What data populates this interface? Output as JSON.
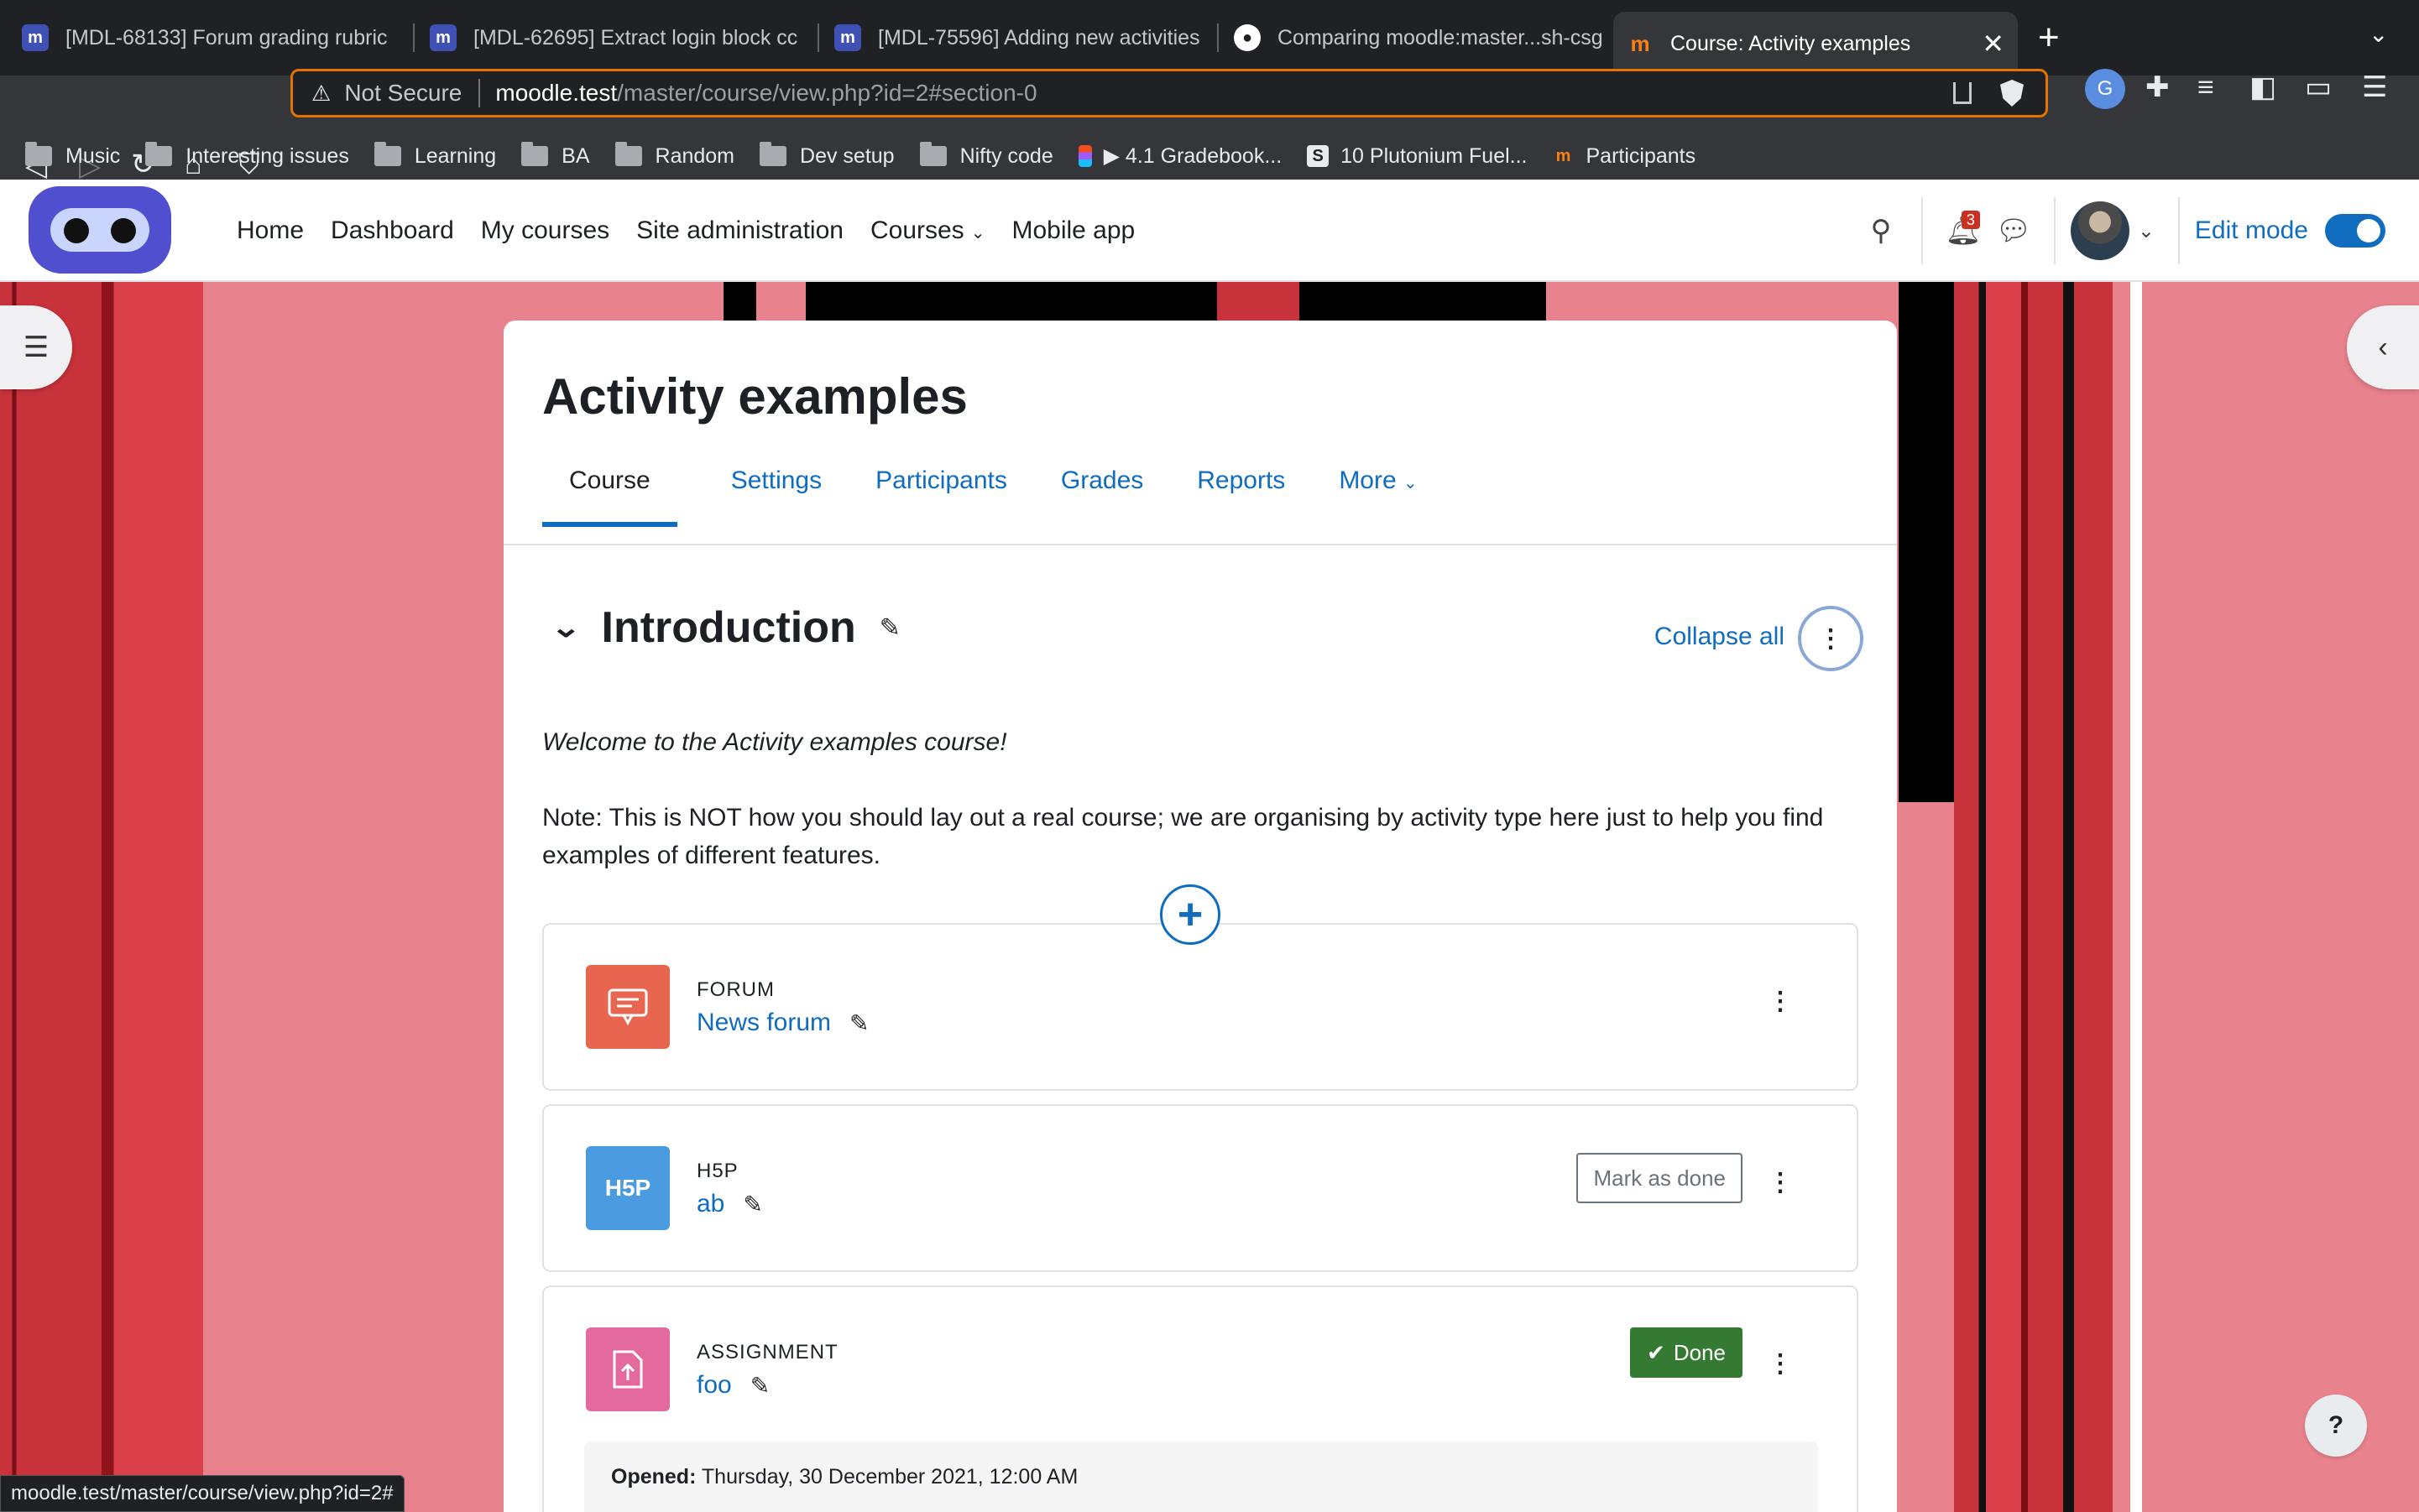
{
  "browser": {
    "tabs": [
      {
        "title": "[MDL-68133] Forum grading rubric",
        "favicon": "moodle-tracker-icon"
      },
      {
        "title": "[MDL-62695] Extract login block cc",
        "favicon": "moodle-tracker-icon"
      },
      {
        "title": "[MDL-75596] Adding new activities",
        "favicon": "moodle-tracker-icon"
      },
      {
        "title": "Comparing moodle:master...sh-csg",
        "favicon": "github-icon"
      },
      {
        "title": "Course: Activity examples",
        "favicon": "moodle-icon",
        "active": true
      }
    ],
    "url": {
      "security": "Not Secure",
      "host": "moodle.test",
      "path": "/master/course/view.php?id=2#section-0"
    },
    "bookmarks": [
      {
        "label": "Music",
        "icon": "folder-icon"
      },
      {
        "label": "Interesting issues",
        "icon": "folder-icon"
      },
      {
        "label": "Learning",
        "icon": "folder-icon"
      },
      {
        "label": "BA",
        "icon": "folder-icon"
      },
      {
        "label": "Random",
        "icon": "folder-icon"
      },
      {
        "label": "Dev setup",
        "icon": "folder-icon"
      },
      {
        "label": "Nifty code",
        "icon": "folder-icon"
      },
      {
        "label": "▶ 4.1 Gradebook...",
        "icon": "figma-icon"
      },
      {
        "label": "10 Plutonium Fuel...",
        "icon": "s-icon"
      },
      {
        "label": "Participants",
        "icon": "moodle-icon"
      }
    ],
    "status_url": "moodle.test/master/course/view.php?id=2#"
  },
  "navbar": {
    "items": [
      "Home",
      "Dashboard",
      "My courses",
      "Site administration",
      "Courses",
      "Mobile app"
    ],
    "notification_count": "3",
    "edit_mode_label": "Edit mode",
    "edit_mode_on": true
  },
  "course": {
    "title": "Activity examples",
    "tabs": [
      "Course",
      "Settings",
      "Participants",
      "Grades",
      "Reports",
      "More"
    ],
    "active_tab": "Course",
    "section": {
      "title": "Introduction",
      "collapse_all": "Collapse all",
      "welcome": "Welcome to the Activity examples course!",
      "note": "Note: This is NOT how you should lay out a real course; we are organising by activity type here just to help you find examples of different features."
    },
    "activities": [
      {
        "type": "FORUM",
        "name": "News forum",
        "icon": "forum-icon",
        "color": "#e8664f"
      },
      {
        "type": "H5P",
        "name": "ab",
        "icon": "h5p-icon",
        "icon_text": "H5P",
        "color": "#4b9be0",
        "completion": "Mark as done"
      },
      {
        "type": "ASSIGNMENT",
        "name": "foo",
        "icon": "assignment-icon",
        "color": "#e46a9e",
        "completion": "Done",
        "opened_label": "Opened:",
        "opened_value": "Thursday, 30 December 2021, 12:00 AM"
      }
    ]
  },
  "help_label": "?",
  "colors": {
    "brand": "#0f6cbf",
    "success": "#357a32",
    "background": "#e8828d"
  }
}
